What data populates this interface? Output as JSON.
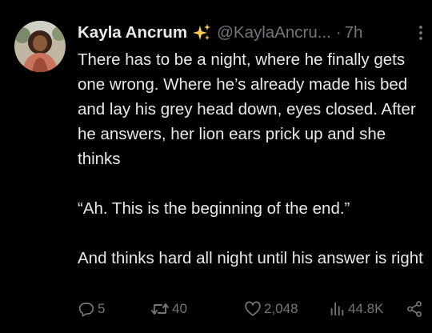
{
  "tweet": {
    "author": {
      "display_name": "Kayla Ancrum",
      "name_emoji_icon": "sparkles-icon",
      "handle": "@KaylaAncru...",
      "separator": "·",
      "time": "7h"
    },
    "paragraphs": [
      "There has to be a night, where he finally gets one wrong. Where he’s already made his bed and lay his grey head down, eyes closed. After he answers, her lion ears prick up and she thinks",
      "“Ah. This is the beginning of the end.”",
      "And thinks hard all night until his answer is right"
    ],
    "stats": {
      "replies": "5",
      "retweets": "40",
      "likes": "2,048",
      "views": "44.8K"
    },
    "icons": {
      "reply": "reply-icon",
      "retweet": "retweet-icon",
      "like": "heart-icon",
      "views": "views-chart-icon",
      "share": "share-icon",
      "more": "more-options-icon"
    }
  },
  "colors": {
    "background": "#000000",
    "primary_text": "#e7e9ea",
    "secondary_text": "#71767b",
    "sparkle": "#ffcc4d"
  }
}
